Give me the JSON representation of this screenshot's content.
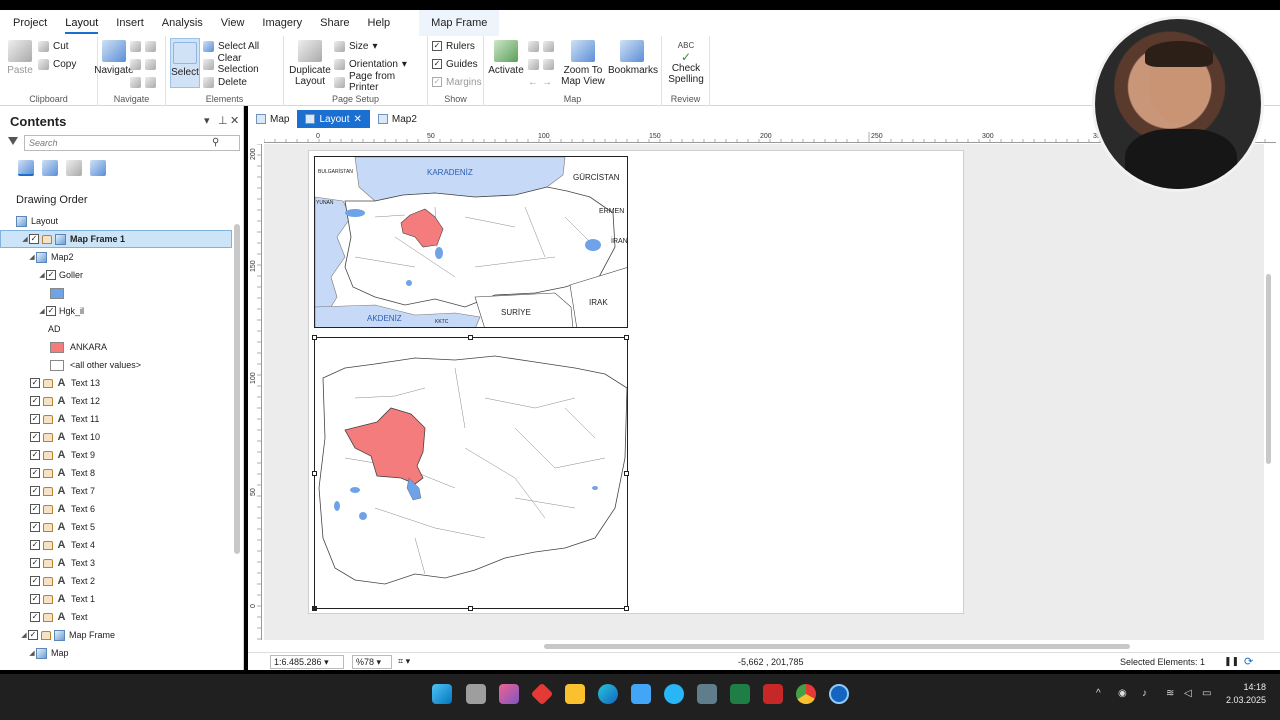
{
  "ribbon_tabs": [
    "Project",
    "Layout",
    "Insert",
    "Analysis",
    "View",
    "Imagery",
    "Share",
    "Help",
    "Map Frame"
  ],
  "ribbon": {
    "clipboard": {
      "paste": "Paste",
      "cut": "Cut",
      "copy": "Copy",
      "name": "Clipboard"
    },
    "navigate": {
      "navigate": "Navigate",
      "name": "Navigate"
    },
    "elements": {
      "select": "Select",
      "select_all": "Select All",
      "clear_selection": "Clear Selection",
      "delete": "Delete",
      "name": "Elements"
    },
    "page_setup": {
      "duplicate_layout": "Duplicate Layout",
      "size": "Size",
      "orientation": "Orientation",
      "page_from_printer": "Page from Printer",
      "name": "Page Setup"
    },
    "show": {
      "rulers": "Rulers",
      "guides": "Guides",
      "margins": "Margins",
      "name": "Show"
    },
    "map": {
      "activate": "Activate",
      "zoom_to_map_view": "Zoom To Map View",
      "bookmarks": "Bookmarks",
      "name": "Map"
    },
    "review": {
      "check_spelling": "Check Spelling",
      "abc": "ABC",
      "name": "Review"
    }
  },
  "contents": {
    "title": "Contents",
    "search_placeholder": "Search",
    "drawing_order": "Drawing Order",
    "items": {
      "layout": "Layout",
      "map_frame_1": "Map Frame 1",
      "map2": "Map2",
      "goller": "Goller",
      "hgk_il": "Hgk_il",
      "ad": "AD",
      "ankara": "ANKARA",
      "all_other": "<all other values>",
      "texts": [
        "Text 13",
        "Text 12",
        "Text 11",
        "Text 10",
        "Text 9",
        "Text 8",
        "Text 7",
        "Text 6",
        "Text 5",
        "Text 4",
        "Text 3",
        "Text 2",
        "Text 1",
        "Text"
      ],
      "map_frame": "Map Frame",
      "map": "Map"
    }
  },
  "doc_tabs": [
    "Map",
    "Layout",
    "Map2"
  ],
  "hruler_labels": [
    "0",
    "50",
    "100",
    "150",
    "200",
    "250",
    "300",
    "35"
  ],
  "vruler_labels": [
    "200",
    "150",
    "100",
    "50",
    "0"
  ],
  "inset_labels": {
    "karadeniz": "KARADENİZ",
    "bulgaristan": "BULGARİSTAN",
    "gurcistan": "GÜRCİSTAN",
    "yunan": "YUNAN",
    "ermen": "ERMEN",
    "iran": "İRAN",
    "irak": "IRAK",
    "suriye": "SURİYE",
    "akdeniz": "AKDENİZ",
    "kktc": "KKTC"
  },
  "status": {
    "scale": "1:6.485.286",
    "zoom": "%78",
    "coords": "-5,662 , 201,785",
    "selected": "Selected Elements: 1"
  },
  "clock": {
    "time": "14:18",
    "date": "2.03.2025"
  },
  "colors": {
    "accent": "#1a6fd1",
    "highlight": "#f47c7c",
    "water": "#6fa3e8",
    "sea": "#c6d9f7"
  }
}
